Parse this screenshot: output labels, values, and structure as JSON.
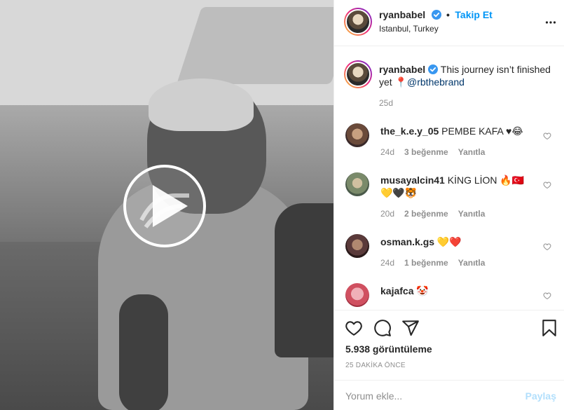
{
  "post": {
    "media_alt": "video",
    "header": {
      "username": "ryanbabel",
      "follow_label": "Takip Et",
      "separator": "•",
      "location": "Istanbul, Turkey",
      "more_icon": "more-horizontal-icon"
    },
    "caption": {
      "username": "ryanbabel",
      "text_before": " This journey isn’t finished yet ",
      "pin_emoji": "📍",
      "mention": "@rbthebrand",
      "age": "25d"
    },
    "comments": [
      {
        "username": "the_k.e.y_05",
        "text": " PEMBE KAFA ♥😂",
        "age": "24d",
        "likes": "3 beğenme",
        "reply": "Yanıtla"
      },
      {
        "username": "musayalcin41",
        "text": " KİNG LİON 🔥🇹🇷 💛🖤🐯",
        "age": "20d",
        "likes": "2 beğenme",
        "reply": "Yanıtla"
      },
      {
        "username": "osman.k.gs",
        "text": " 💛❤️",
        "age": "24d",
        "likes": "1 beğenme",
        "reply": "Yanıtla"
      },
      {
        "username": "kajafca",
        "text": " 🤡",
        "age": "",
        "likes": "",
        "reply": ""
      }
    ],
    "actions": {
      "like_icon": "heart-icon",
      "comment_icon": "comment-icon",
      "share_icon": "share-icon",
      "save_icon": "bookmark-icon"
    },
    "views": "5.938 görüntüleme",
    "time_ago": "25 DAKİKA ÖNCE",
    "add_comment": {
      "placeholder": "Yorum ekle...",
      "post_label": "Paylaş"
    }
  },
  "colors": {
    "link_blue": "#0095f6",
    "post_disabled": "#b2dffc",
    "muted": "#8e8e8e",
    "text": "#262626"
  }
}
